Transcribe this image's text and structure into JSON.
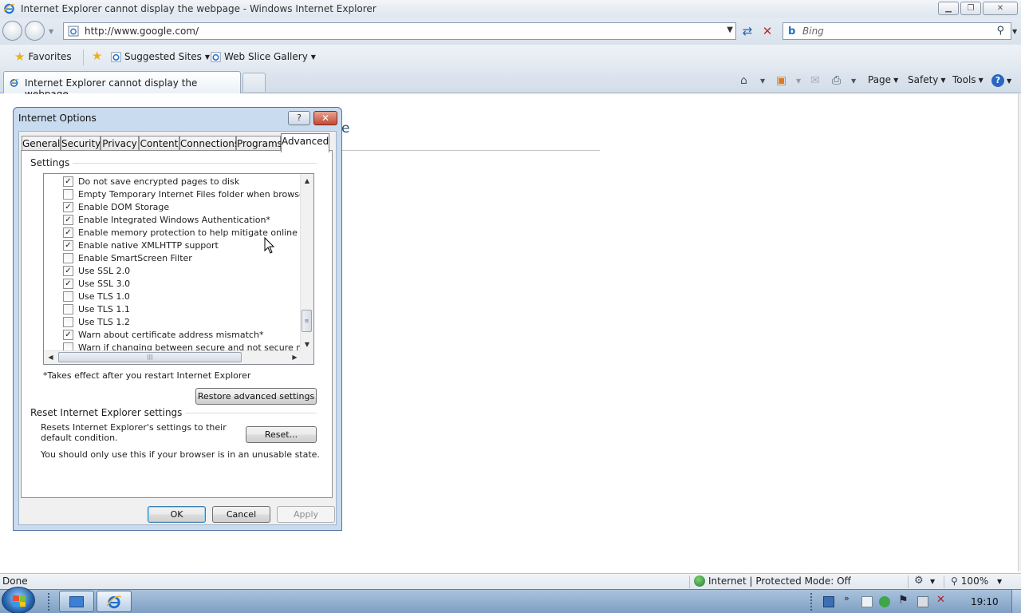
{
  "window": {
    "title": "Internet Explorer cannot display the webpage - Windows Internet Explorer"
  },
  "address": {
    "url": "http://www.google.com/",
    "search_placeholder": "Bing"
  },
  "favorites_bar": {
    "favorites_label": "Favorites",
    "suggested_sites": "Suggested Sites",
    "web_slice_gallery": "Web Slice Gallery"
  },
  "tabs": {
    "active_tab_label": "Internet Explorer cannot display the webpage"
  },
  "command_bar": {
    "page": "Page",
    "safety": "Safety",
    "tools": "Tools"
  },
  "content": {
    "title_fragment": "e"
  },
  "dialog": {
    "title": "Internet Options",
    "help_label": "?",
    "tabs": [
      "General",
      "Security",
      "Privacy",
      "Content",
      "Connections",
      "Programs",
      "Advanced"
    ],
    "active_tab": "Advanced",
    "settings_group_label": "Settings",
    "settings": [
      {
        "label": "Do not save encrypted pages to disk",
        "checked": true
      },
      {
        "label": "Empty Temporary Internet Files folder when browser is clo",
        "checked": false
      },
      {
        "label": "Enable DOM Storage",
        "checked": true
      },
      {
        "label": "Enable Integrated Windows Authentication*",
        "checked": true
      },
      {
        "label": "Enable memory protection to help mitigate online attacks*",
        "checked": true
      },
      {
        "label": "Enable native XMLHTTP support",
        "checked": true
      },
      {
        "label": "Enable SmartScreen Filter",
        "checked": false
      },
      {
        "label": "Use SSL 2.0",
        "checked": true
      },
      {
        "label": "Use SSL 3.0",
        "checked": true
      },
      {
        "label": "Use TLS 1.0",
        "checked": false
      },
      {
        "label": "Use TLS 1.1",
        "checked": false
      },
      {
        "label": "Use TLS 1.2",
        "checked": false
      },
      {
        "label": "Warn about certificate address mismatch*",
        "checked": true
      },
      {
        "label": "Warn if changing between secure and not secure mode",
        "checked": false
      }
    ],
    "restart_note": "*Takes effect after you restart Internet Explorer",
    "restore_button": "Restore advanced settings",
    "reset_group_label": "Reset Internet Explorer settings",
    "reset_description": "Resets Internet Explorer's settings to their default condition.",
    "reset_button": "Reset...",
    "reset_warning": "You should only use this if your browser is in an unusable state.",
    "ok_button": "OK",
    "cancel_button": "Cancel",
    "apply_button": "Apply"
  },
  "status_bar": {
    "status_text": "Done",
    "zone_text": "Internet | Protected Mode: Off",
    "zoom_text": "100%"
  },
  "taskbar": {
    "clock": "19:10"
  },
  "colors": {
    "accent": "#2b4e7a",
    "dialog_frame": "#c9dbef",
    "close_red": "#c24a33"
  }
}
